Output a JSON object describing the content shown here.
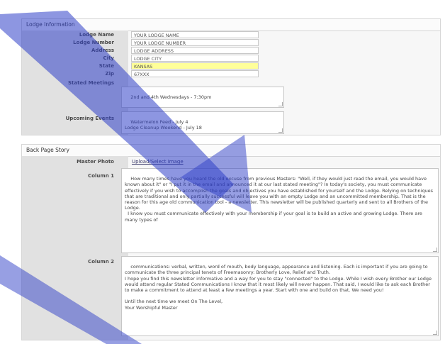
{
  "lodge_info": {
    "title": "Lodge Information",
    "fields": [
      {
        "label": "Lodge Name",
        "value": "YOUR LODGE NAME"
      },
      {
        "label": "Lodge Number",
        "value": "YOUR LODGE NUMBER"
      },
      {
        "label": "Address",
        "value": "LODGE ADDRESS"
      },
      {
        "label": "City",
        "value": "LODGE CITY"
      },
      {
        "label": "State",
        "value": "KANSAS"
      },
      {
        "label": "Zip",
        "value": "67XXX"
      }
    ],
    "stated_meetings": {
      "label": "Stated Meetings",
      "value": "2nd and 4th Wednesdays - 7:30pm"
    },
    "upcoming_events": {
      "label": "Upcoming Events",
      "value": "Watermelon Feed - July 4\nLodge Cleanup Weekend - July 18"
    }
  },
  "back_page": {
    "title": "Back Page Story",
    "master_photo": {
      "label": "Master Photo",
      "link": "Upload/Select Image"
    },
    "column1": {
      "label": "Column 1",
      "value": "How many times have you heard the old excuse from previous Masters: \"Well, if they would just read the email, you would have known about it\" or \"I put it in the email and announced it at our last stated meeting\"? In today's society, you must communicate effectively if you wish to accomplish the goals and objectives you have established for yourself and the Lodge. Relying on techniques that are traditional and only partially successful will leave you with an empty Lodge and an uncommitted membership. That is the reason for this age old communication tool - a newsletter. This newsletter will be published quarterly and sent to all Brothers of the Lodge.\n  I know you must communicate effectively with your membership if your goal is to build an active and growing Lodge. There are many types of"
    },
    "column2": {
      "label": "Column 2",
      "value": "communications: verbal, written, word of mouth, body language, appearance and listening. Each is important if you are going to communicate the three principal tenets of Freemasonry: Brotherly Love, Relief and Truth.\nI hope you find this newsletter informative and a way for you to stay \"connected\" to the Lodge. While I wish every Brother our Lodge would attend regular Stated Communications I know that it most likely will never happen. That said, I would like to ask each Brother to make a commitment to attend at least a few meetings a year. Start with one and build on that. We need you!\n\nUntil the next time we meet On The Level,\nYour Worshipful Master"
    }
  },
  "colors": {
    "swoosh": "#2f3fc8",
    "highlight": "#ffff99"
  }
}
